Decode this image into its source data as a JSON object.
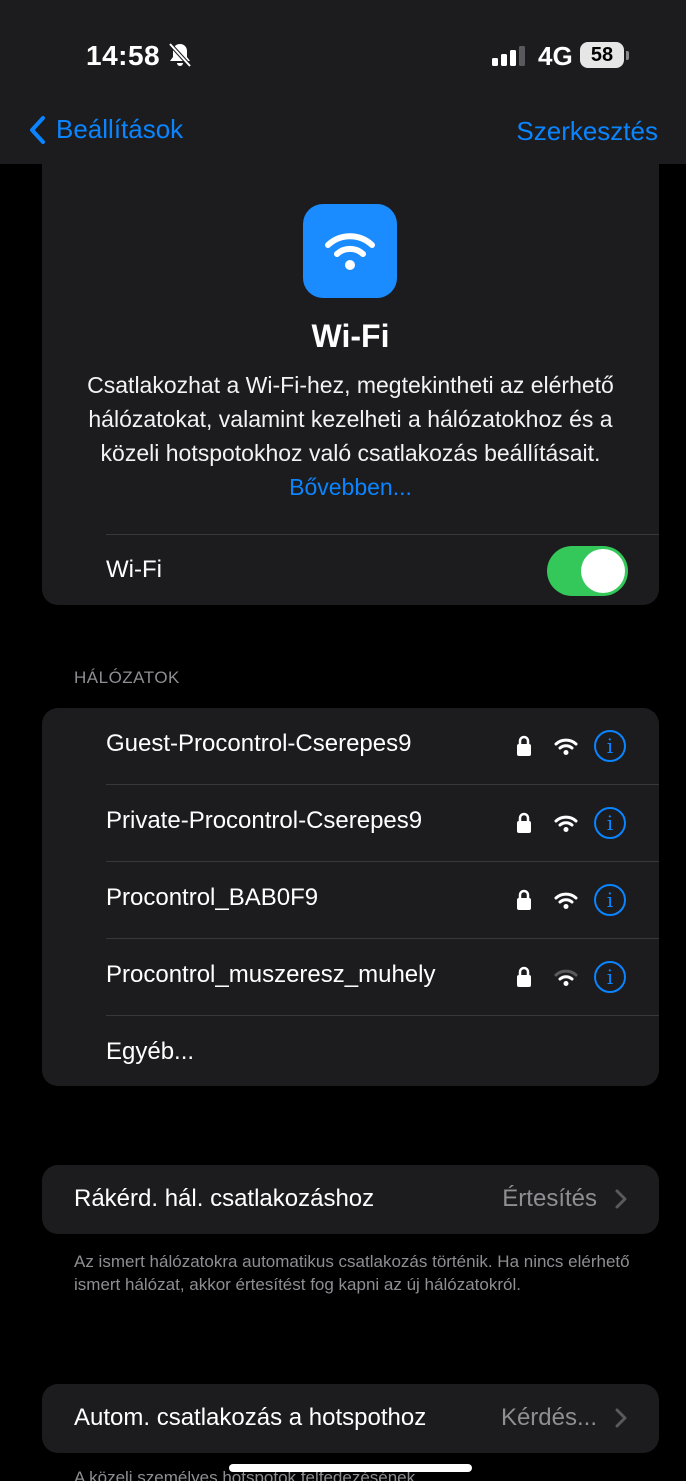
{
  "status_bar": {
    "time": "14:58",
    "network": "4G",
    "battery": "58"
  },
  "nav": {
    "back_label": "Beállítások",
    "edit_label": "Szerkesztés"
  },
  "hero": {
    "title": "Wi-Fi",
    "description": "Csatlakozhat a Wi-Fi-hez, megtekintheti az elérhető hálózatokat, valamint kezelheti a hálózatokhoz és a közeli hotspotokhoz való csatlakozás beállításait.",
    "more_link": "Bővebben...",
    "toggle_label": "Wi-Fi",
    "toggle_on": true,
    "accent": "#34c759"
  },
  "networks": {
    "header": "HÁLÓZATOK",
    "items": [
      {
        "name": "Guest-Procontrol-Cserepes9"
      },
      {
        "name": "Private-Procontrol-Cserepes9"
      },
      {
        "name": "Procontrol_BAB0F9"
      },
      {
        "name": "Procontrol_muszeresz_muhely"
      }
    ],
    "other": "Egyéb..."
  },
  "ask_to_join": {
    "label": "Rákérd. hál. csatlakozáshoz",
    "value": "Értesítés",
    "footnote": "Az ismert hálózatokra automatikus csatlakozás történik. Ha nincs elérhető ismert hálózat, akkor értesítést fog kapni az új hálózatokról."
  },
  "auto_hotspot": {
    "label": "Autom. csatlakozás a hotspothoz",
    "value": "Kérdés...",
    "footnote": "A közeli személyes hotspotok felfedezésének"
  },
  "colors": {
    "link": "#0a84ff",
    "background": "#000000",
    "card": "#1c1c1e"
  }
}
